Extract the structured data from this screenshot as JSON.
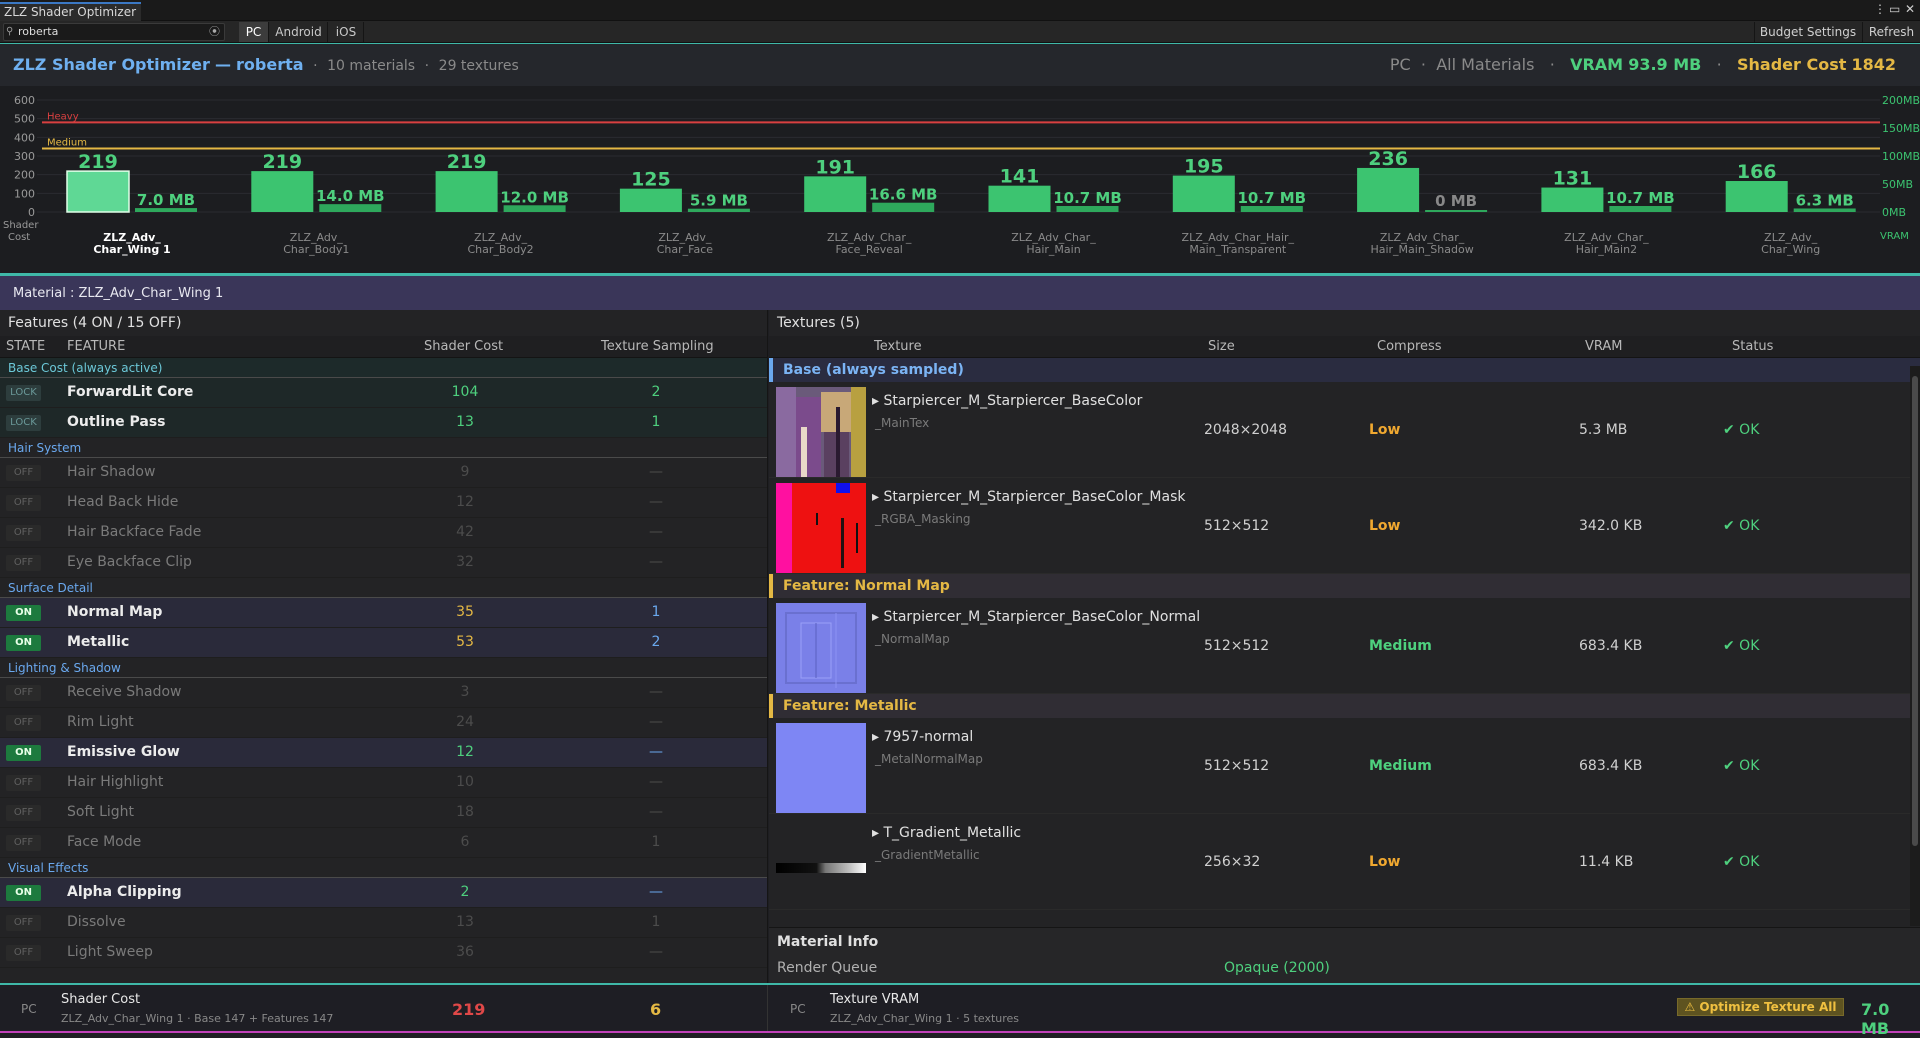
{
  "window": {
    "tab_title": "ZLZ Shader Optimizer",
    "menu_icon": "⋮",
    "maximize_icon": "▭",
    "close_icon": "✕"
  },
  "toolbar": {
    "search_value": "roberta",
    "platform_tabs": [
      "PC",
      "Android",
      "iOS"
    ],
    "budget_label": "Budget Settings",
    "refresh_label": "Refresh"
  },
  "header": {
    "title": "ZLZ Shader Optimizer",
    "sep": "—",
    "user": "roberta",
    "materials": "10 materials",
    "textures": "29 textures",
    "platform": "PC",
    "scope": "All Materials",
    "vram_label": "VRAM",
    "vram_value": "93.9 MB",
    "cost_label": "Shader Cost",
    "cost_value": "1842"
  },
  "chart_data": {
    "type": "bar",
    "title": "",
    "ylabel": "Shader Cost",
    "y2label": "VRAM",
    "ylim": [
      0,
      600
    ],
    "yticks": [
      "600",
      "500",
      "400",
      "300",
      "200",
      "100",
      "0"
    ],
    "y2lim": [
      0,
      200
    ],
    "y2ticks": [
      "200MB",
      "150MB",
      "100MB",
      "50MB",
      "0MB"
    ],
    "thresholds": [
      {
        "name": "Heavy",
        "value": 480,
        "color": "#d84040"
      },
      {
        "name": "Medium",
        "value": 340,
        "color": "#e4b844"
      }
    ],
    "categories": [
      "ZLZ_Adv_\nChar_Wing 1",
      "ZLZ_Adv_\nChar_Body1",
      "ZLZ_Adv_\nChar_Body2",
      "ZLZ_Adv_\nChar_Face",
      "ZLZ_Adv_Char_\nFace_Reveal",
      "ZLZ_Adv_Char_\nHair_Main",
      "ZLZ_Adv_Char_Hair_\nMain_Transparent",
      "ZLZ_Adv_Char_\nHair_Main_Shadow",
      "ZLZ_Adv_Char_\nHair_Main2",
      "ZLZ_Adv_\nChar_Wing"
    ],
    "selected": 0,
    "series": [
      {
        "name": "Shader Cost",
        "values": [
          219,
          219,
          219,
          125,
          191,
          141,
          195,
          236,
          131,
          166
        ]
      },
      {
        "name": "VRAM",
        "values": [
          7.0,
          14.0,
          12.0,
          5.9,
          16.6,
          10.7,
          10.7,
          0,
          10.7,
          6.3
        ],
        "labels": [
          "7.0 MB",
          "14.0 MB",
          "12.0 MB",
          "5.9 MB",
          "16.6 MB",
          "10.7 MB",
          "10.7 MB",
          "0 MB",
          "10.7 MB",
          "6.3 MB"
        ]
      }
    ]
  },
  "material_bar": {
    "label": "Material : ZLZ_Adv_Char_Wing 1"
  },
  "features": {
    "title": "Features  (4 ON / 15 OFF)",
    "columns": {
      "state": "STATE",
      "feature": "FEATURE",
      "cost": "Shader Cost",
      "sampling": "Texture Sampling"
    },
    "sections": [
      {
        "name": "Base Cost  (always active)",
        "base": true,
        "rows": [
          {
            "state": "LOCK",
            "name": "ForwardLit Core",
            "cost": "104",
            "samp": "2"
          },
          {
            "state": "LOCK",
            "name": "Outline Pass",
            "cost": "13",
            "samp": "1"
          }
        ]
      },
      {
        "name": "Hair System",
        "rows": [
          {
            "state": "OFF",
            "name": "Hair Shadow",
            "cost": "9",
            "samp": "—"
          },
          {
            "state": "OFF",
            "name": "Head Back Hide",
            "cost": "12",
            "samp": "—"
          },
          {
            "state": "OFF",
            "name": "Hair Backface Fade",
            "cost": "42",
            "samp": "—"
          },
          {
            "state": "OFF",
            "name": "Eye Backface Clip",
            "cost": "32",
            "samp": "—"
          }
        ]
      },
      {
        "name": "Surface Detail",
        "rows": [
          {
            "state": "ON",
            "name": "Normal Map",
            "cost": "35",
            "samp": "1",
            "cost_color": "gold"
          },
          {
            "state": "ON",
            "name": "Metallic",
            "cost": "53",
            "samp": "2",
            "cost_color": "gold"
          }
        ]
      },
      {
        "name": "Lighting & Shadow",
        "rows": [
          {
            "state": "OFF",
            "name": "Receive Shadow",
            "cost": "3",
            "samp": "—"
          },
          {
            "state": "OFF",
            "name": "Rim Light",
            "cost": "24",
            "samp": "—"
          },
          {
            "state": "ON",
            "name": "Emissive Glow",
            "cost": "12",
            "samp": "—",
            "cost_color": "green"
          },
          {
            "state": "OFF",
            "name": "Hair Highlight",
            "cost": "10",
            "samp": "—"
          },
          {
            "state": "OFF",
            "name": "Soft Light",
            "cost": "18",
            "samp": "—"
          },
          {
            "state": "OFF",
            "name": "Face Mode",
            "cost": "6",
            "samp": "1"
          }
        ]
      },
      {
        "name": "Visual Effects",
        "rows": [
          {
            "state": "ON",
            "name": "Alpha Clipping",
            "cost": "2",
            "samp": "—",
            "cost_color": "green"
          },
          {
            "state": "OFF",
            "name": "Dissolve",
            "cost": "13",
            "samp": "1"
          },
          {
            "state": "OFF",
            "name": "Light Sweep",
            "cost": "36",
            "samp": "—"
          }
        ]
      }
    ]
  },
  "textures": {
    "title": "Textures  (5)",
    "columns": {
      "texture": "Texture",
      "size": "Size",
      "compress": "Compress",
      "vram": "VRAM",
      "status": "Status"
    },
    "sections": [
      {
        "name": "Base  (always sampled)",
        "type": "base",
        "rows": [
          {
            "name": "▸ Starpiercer_M_Starpiercer_BaseColor",
            "prop": "_MainTex",
            "size": "2048×2048",
            "compress": "Low",
            "vram": "5.3 MB",
            "status": "✔ OK",
            "thumb": "basecolor"
          },
          {
            "name": "▸ Starpiercer_M_Starpiercer_BaseColor_Mask",
            "prop": "_RGBA_Masking",
            "size": "512×512",
            "compress": "Low",
            "vram": "342.0 KB",
            "status": "✔ OK",
            "thumb": "mask"
          }
        ]
      },
      {
        "name": "Feature: Normal Map",
        "type": "feat",
        "rows": [
          {
            "name": "▸ Starpiercer_M_Starpiercer_BaseColor_Normal",
            "prop": "_NormalMap",
            "size": "512×512",
            "compress": "Medium",
            "vram": "683.4 KB",
            "status": "✔ OK",
            "thumb": "normal"
          }
        ]
      },
      {
        "name": "Feature: Metallic",
        "type": "feat",
        "rows": [
          {
            "name": "▸ 7957-normal",
            "prop": "_MetalNormalMap",
            "size": "512×512",
            "compress": "Medium",
            "vram": "683.4 KB",
            "status": "✔ OK",
            "thumb": "flatnormal"
          },
          {
            "name": "▸ T_Gradient_Metallic",
            "prop": "_GradientMetallic",
            "size": "256×32",
            "compress": "Low",
            "vram": "11.4 KB",
            "status": "✔ OK",
            "thumb": "gradient"
          }
        ]
      }
    ]
  },
  "material_info": {
    "title": "Material Info",
    "render_queue_label": "Render Queue",
    "render_queue_value": "Opaque (2000)"
  },
  "footer": {
    "left": {
      "platform": "PC",
      "title": "Shader Cost",
      "sub": "ZLZ_Adv_Char_Wing 1  ·  Base 147  +  Features 147",
      "cost": "219",
      "samp": "6"
    },
    "right": {
      "platform": "PC",
      "title": "Texture VRAM",
      "sub": "ZLZ_Adv_Char_Wing 1  ·  5 textures",
      "button": "⚠  Optimize Texture All",
      "vram": "7.0 MB"
    }
  },
  "colors": {
    "accent_teal": "#3fb8a8",
    "green": "#4ed07e",
    "gold": "#e4b844",
    "blue": "#6aa8ee",
    "red": "#e04848",
    "heavy": "#d84040",
    "bar": "#3cc470",
    "bar_selected": "#5fd895"
  }
}
